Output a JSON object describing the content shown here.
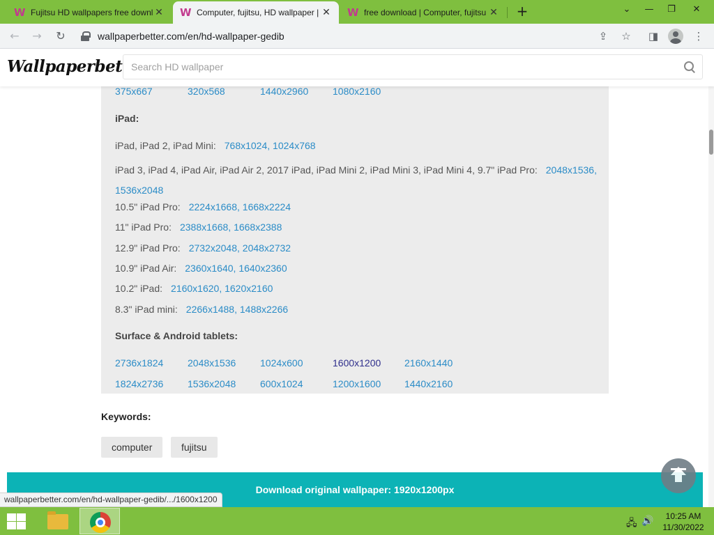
{
  "browser": {
    "tabs": [
      {
        "title": "Fujitsu HD wallpapers free downl",
        "favicon": "W",
        "close": "✕"
      },
      {
        "title": "Computer, fujitsu, HD wallpaper |",
        "favicon": "W",
        "close": "✕"
      },
      {
        "title": "free download | Computer, fujitsu",
        "favicon": "W",
        "close": "✕"
      }
    ],
    "new_tab": "+",
    "url": "wallpaperbetter.com/en/hd-wallpaper-gedib",
    "window_controls": {
      "minimize": "⌄",
      "restore": "—",
      "maximize": "❐",
      "close": "✕"
    },
    "status_url": "wallpaperbetter.com/en/hd-wallpaper-gedib/.../1600x1200"
  },
  "site": {
    "logo": "Wallpaperbetter",
    "search_placeholder": "Search HD wallpaper"
  },
  "resolutions": {
    "top_row": [
      "375x667",
      "320x568",
      "1440x2960",
      "1080x2160"
    ],
    "ipad_heading": "iPad:",
    "ipad_lines": [
      {
        "label": "iPad, iPad 2, iPad Mini:",
        "links": [
          "768x1024",
          "1024x768"
        ]
      },
      {
        "label": "iPad 3, iPad 4, iPad Air, iPad Air 2, 2017 iPad, iPad Mini 2, iPad Mini 3, iPad Mini 4, 9.7\" iPad Pro:",
        "links": [
          "2048x1536",
          "1536x2048"
        ]
      },
      {
        "label": "10.5\" iPad Pro:",
        "links": [
          "2224x1668",
          "1668x2224"
        ]
      },
      {
        "label": "11\" iPad Pro:",
        "links": [
          "2388x1668",
          "1668x2388"
        ]
      },
      {
        "label": "12.9\" iPad Pro:",
        "links": [
          "2732x2048",
          "2048x2732"
        ]
      },
      {
        "label": "10.9\" iPad Air:",
        "links": [
          "2360x1640",
          "1640x2360"
        ]
      },
      {
        "label": "10.2\" iPad:",
        "links": [
          "2160x1620",
          "1620x2160"
        ]
      },
      {
        "label": "8.3\" iPad mini:",
        "links": [
          "2266x1488",
          "1488x2266"
        ]
      }
    ],
    "surface_heading": "Surface & Android tablets:",
    "surface_row1": [
      "2736x1824",
      "2048x1536",
      "1024x600",
      "1600x1200",
      "2160x1440"
    ],
    "surface_row2": [
      "1824x2736",
      "1536x2048",
      "600x1024",
      "1200x1600",
      "1440x2160"
    ],
    "visited": "1600x1200"
  },
  "keywords": {
    "title": "Keywords:",
    "tags": [
      "computer",
      "fujitsu"
    ]
  },
  "download": {
    "label": "Download original wallpaper: 1920x1200px"
  },
  "taskbar": {
    "time": "10:25 AM",
    "date": "11/30/2022"
  },
  "colors": {
    "link": "#2b8cc7",
    "visited_link": "#2f2f8c",
    "download_bar": "#0cb3b6",
    "chrome_frame": "#7fbf3f",
    "panel_bg": "#ececec"
  }
}
